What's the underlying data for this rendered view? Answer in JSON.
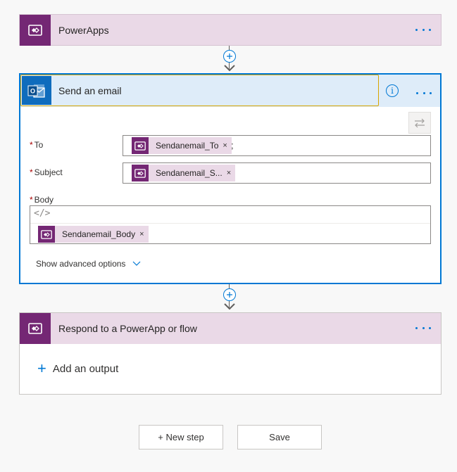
{
  "trigger": {
    "title": "PowerApps",
    "icon": "powerapps-icon"
  },
  "action": {
    "title": "Send an email",
    "icon": "outlook-icon",
    "info_glyph": "i",
    "fields": {
      "to": {
        "label": "To",
        "required": "*",
        "token": "Sendanemail_To",
        "suffix": ";"
      },
      "subject": {
        "label": "Subject",
        "required": "*",
        "token": "Sendanemail_S..."
      },
      "body": {
        "label": "Body",
        "required": "*",
        "token": "Sendanemail_Body",
        "code_glyph": "</>"
      }
    },
    "advanced": "Show advanced options"
  },
  "response": {
    "title": "Respond to a PowerApp or flow",
    "icon": "powerapps-icon",
    "add_output": "Add an output",
    "add_glyph": "+"
  },
  "buttons": {
    "new_step": "+ New step",
    "save": "Save"
  },
  "token_remove_glyph": "×",
  "colors": {
    "accent": "#0078d4",
    "powerapps_purple": "#742774",
    "powerapps_tint": "#ead9e7",
    "outlook_blue": "#0f6cbd",
    "header_blue": "#deecf9",
    "focus_outline": "#d8a500",
    "required": "#a80000"
  }
}
